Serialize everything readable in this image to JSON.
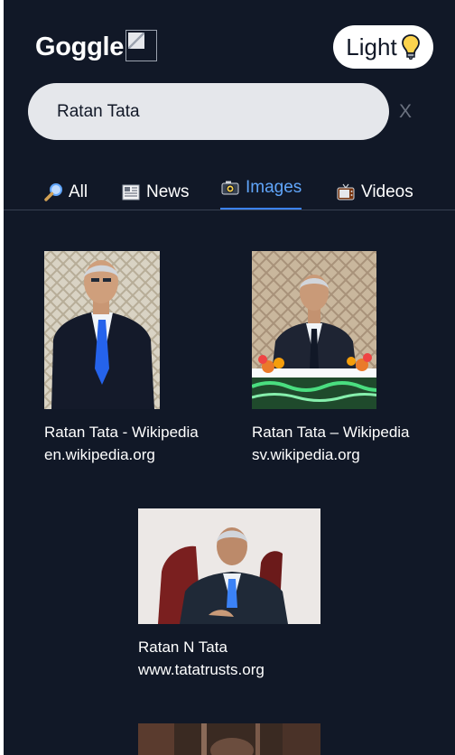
{
  "header": {
    "logo_text": "Goggle",
    "theme_label": "Light"
  },
  "search": {
    "value": "Ratan Tata",
    "clear_label": "X"
  },
  "tabs": [
    {
      "label": "All",
      "icon": "magnifier-icon",
      "active": false
    },
    {
      "label": "News",
      "icon": "newspaper-icon",
      "active": false
    },
    {
      "label": "Images",
      "icon": "camera-icon",
      "active": true
    },
    {
      "label": "Videos",
      "icon": "television-icon",
      "active": false
    }
  ],
  "results": [
    {
      "title": "Ratan Tata - Wikipedia",
      "source": "en.wikipedia.org"
    },
    {
      "title": "Ratan Tata – Wikipedia",
      "source": "sv.wikipedia.org"
    },
    {
      "title": "Ratan N Tata",
      "source": "www.tatatrusts.org"
    }
  ],
  "colors": {
    "background": "#111827",
    "active_tab": "#60a5fa",
    "search_bg": "#e5e7eb"
  }
}
